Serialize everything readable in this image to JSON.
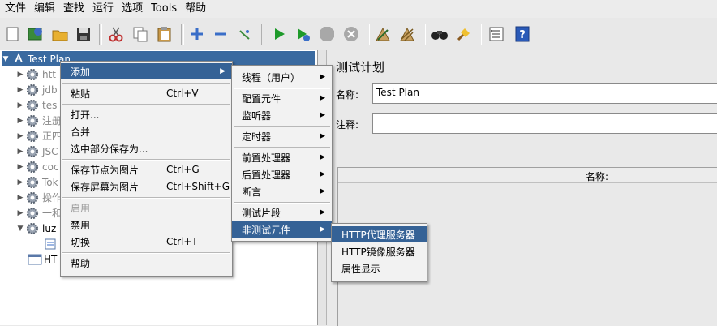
{
  "menubar": [
    "文件",
    "编辑",
    "查找",
    "运行",
    "选项",
    "Tools",
    "帮助"
  ],
  "toolbar_icons": [
    "new-icon",
    "templates-icon",
    "open-icon",
    "save-icon",
    "cut-icon",
    "copy-icon",
    "paste-icon",
    "expand-icon",
    "collapse-icon",
    "toggle-icon",
    "start-icon",
    "start-no-pause-icon",
    "stop-icon",
    "shutdown-icon",
    "clear-icon",
    "clear-all-icon",
    "search-icon",
    "reset-search-icon",
    "function-helper-icon",
    "help-icon"
  ],
  "tree": {
    "root": "Test Plan",
    "items": [
      "htt",
      "jdb",
      "tes",
      "注册",
      "正四",
      "JSC",
      "coc",
      "Tok",
      "操作",
      "一和",
      "luz"
    ],
    "child_under_luz": "",
    "last_item": "HT"
  },
  "context_menu": {
    "add": "添加",
    "paste": "粘贴",
    "paste_accel": "Ctrl+V",
    "open": "打开...",
    "merge": "合并",
    "save_selection": "选中部分保存为...",
    "save_node_image": "保存节点为图片",
    "save_node_image_accel": "Ctrl+G",
    "save_screen_image": "保存屏幕为图片",
    "save_screen_image_accel": "Ctrl+Shift+G",
    "enable": "启用",
    "disable": "禁用",
    "toggle": "切换",
    "toggle_accel": "Ctrl+T",
    "help": "帮助"
  },
  "add_submenu": {
    "threads": "线程（用户）",
    "config": "配置元件",
    "listener": "监听器",
    "timer": "定时器",
    "pre": "前置处理器",
    "post": "后置处理器",
    "assertion": "断言",
    "fragment": "测试片段",
    "non_test": "非测试元件"
  },
  "non_test_submenu": {
    "proxy": "HTTP代理服务器",
    "mirror": "HTTP镜像服务器",
    "props": "属性显示"
  },
  "panel": {
    "title": "测试计划",
    "name_label": "名称:",
    "name_value": "Test Plan",
    "comment_label": "注释:",
    "table_header": "名称:"
  },
  "colors": {
    "highlight": "#356296",
    "tree_selected": "#3a6aa0"
  }
}
